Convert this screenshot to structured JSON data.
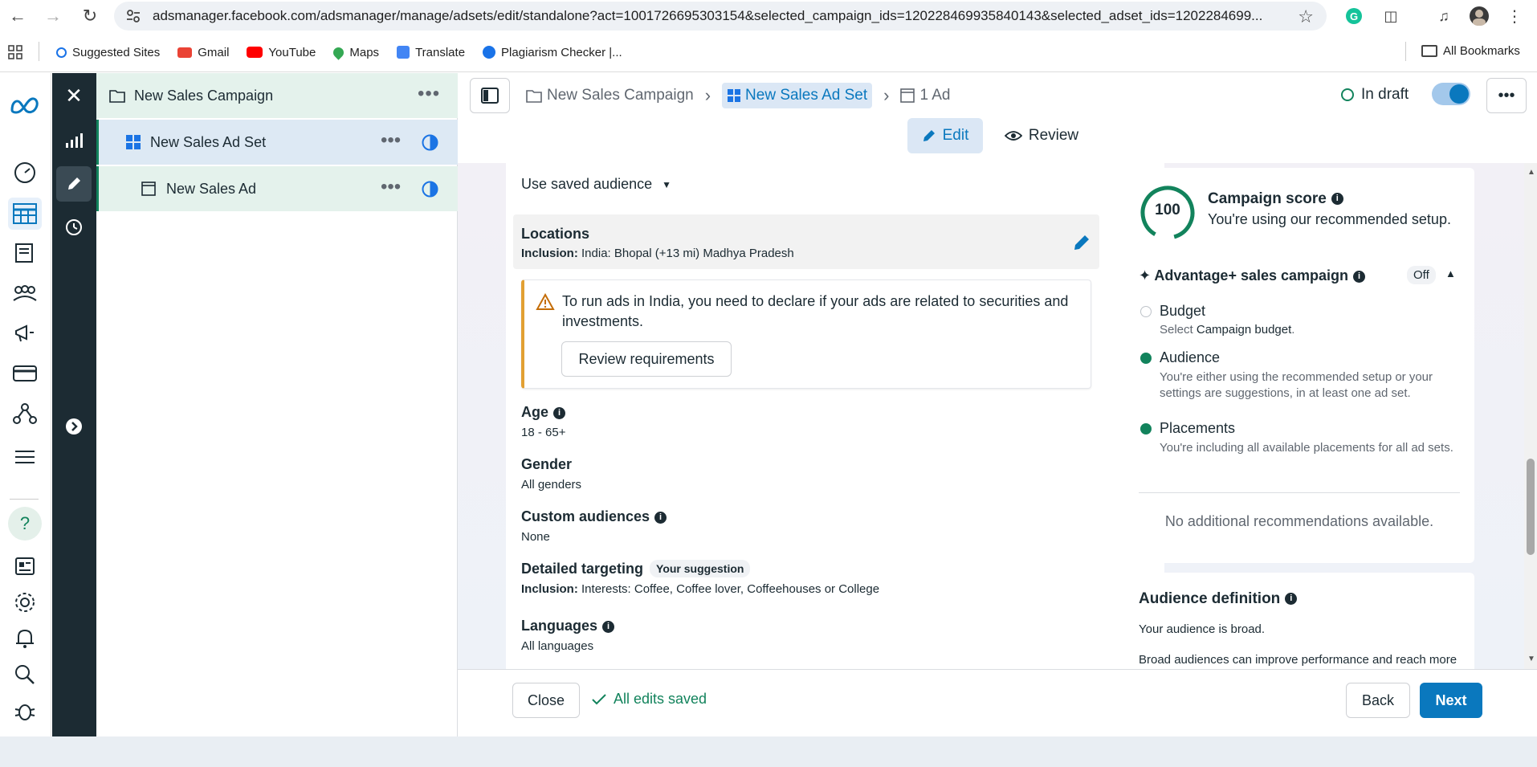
{
  "browser": {
    "url": "adsmanager.facebook.com/adsmanager/manage/adsets/edit/standalone?act=1001726695303154&selected_campaign_ids=120228469935840143&selected_adset_ids=1202284699...",
    "bookmarks": [
      {
        "label": "Suggested Sites",
        "color": "#1a73e8"
      },
      {
        "label": "Gmail",
        "color": "#ea4335"
      },
      {
        "label": "YouTube",
        "color": "#ff0000"
      },
      {
        "label": "Maps",
        "color": "#34a853"
      },
      {
        "label": "Translate",
        "color": "#4285f4"
      },
      {
        "label": "Plagiarism Checker |...",
        "color": "#1a73e8"
      }
    ],
    "all_bookmarks": "All Bookmarks"
  },
  "tree": {
    "campaign": "New Sales Campaign",
    "adset": "New Sales Ad Set",
    "ad": "New Sales Ad"
  },
  "header": {
    "crumb_campaign": "New Sales Campaign",
    "crumb_adset": "New Sales Ad Set",
    "crumb_ad": "1 Ad",
    "status": "In draft",
    "edit_tab": "Edit",
    "review_tab": "Review"
  },
  "audience": {
    "saved_audience": "Use saved audience",
    "locations_title": "Locations",
    "locations_label": "Inclusion:",
    "locations_value": " India: Bhopal (+13 mi) Madhya Pradesh",
    "warning_text": "To run ads in India, you need to declare if your ads are related to securities and investments.",
    "review_button": "Review requirements",
    "age_title": "Age",
    "age_value": "18 - 65+",
    "gender_title": "Gender",
    "gender_value": "All genders",
    "custom_title": "Custom audiences",
    "custom_value": "None",
    "detailed_title": "Detailed targeting",
    "detailed_badge": "Your suggestion",
    "detailed_label": "Inclusion:",
    "detailed_value": " Interests: Coffee, Coffee lover, Coffeehouses or College",
    "languages_title": "Languages",
    "languages_value": "All languages"
  },
  "score": {
    "value": "100",
    "title": "Campaign score",
    "subtitle": "You're using our recommended setup.",
    "advantage_title": "Advantage+ sales campaign",
    "advantage_state": "Off",
    "items": [
      {
        "title": "Budget",
        "desc_pre": "Select ",
        "desc_bold": "Campaign budget",
        "desc_post": ".",
        "done": false
      },
      {
        "title": "Audience",
        "desc": "You're either using the recommended setup or your settings are suggestions, in at least one ad set.",
        "done": true
      },
      {
        "title": "Placements",
        "desc": "You're including all available placements for all ad sets.",
        "done": true
      }
    ],
    "no_more": "No additional recommendations available."
  },
  "definition": {
    "title": "Audience definition",
    "line1": "Your audience is broad.",
    "line2": "Broad audiences can improve performance and reach more"
  },
  "footer": {
    "close": "Close",
    "saved": "All edits saved",
    "back": "Back",
    "next": "Next"
  },
  "colors": {
    "accent": "#0a78be",
    "success": "#12835c",
    "warning": "#e2a033",
    "dark_rail": "#1c2b33"
  }
}
